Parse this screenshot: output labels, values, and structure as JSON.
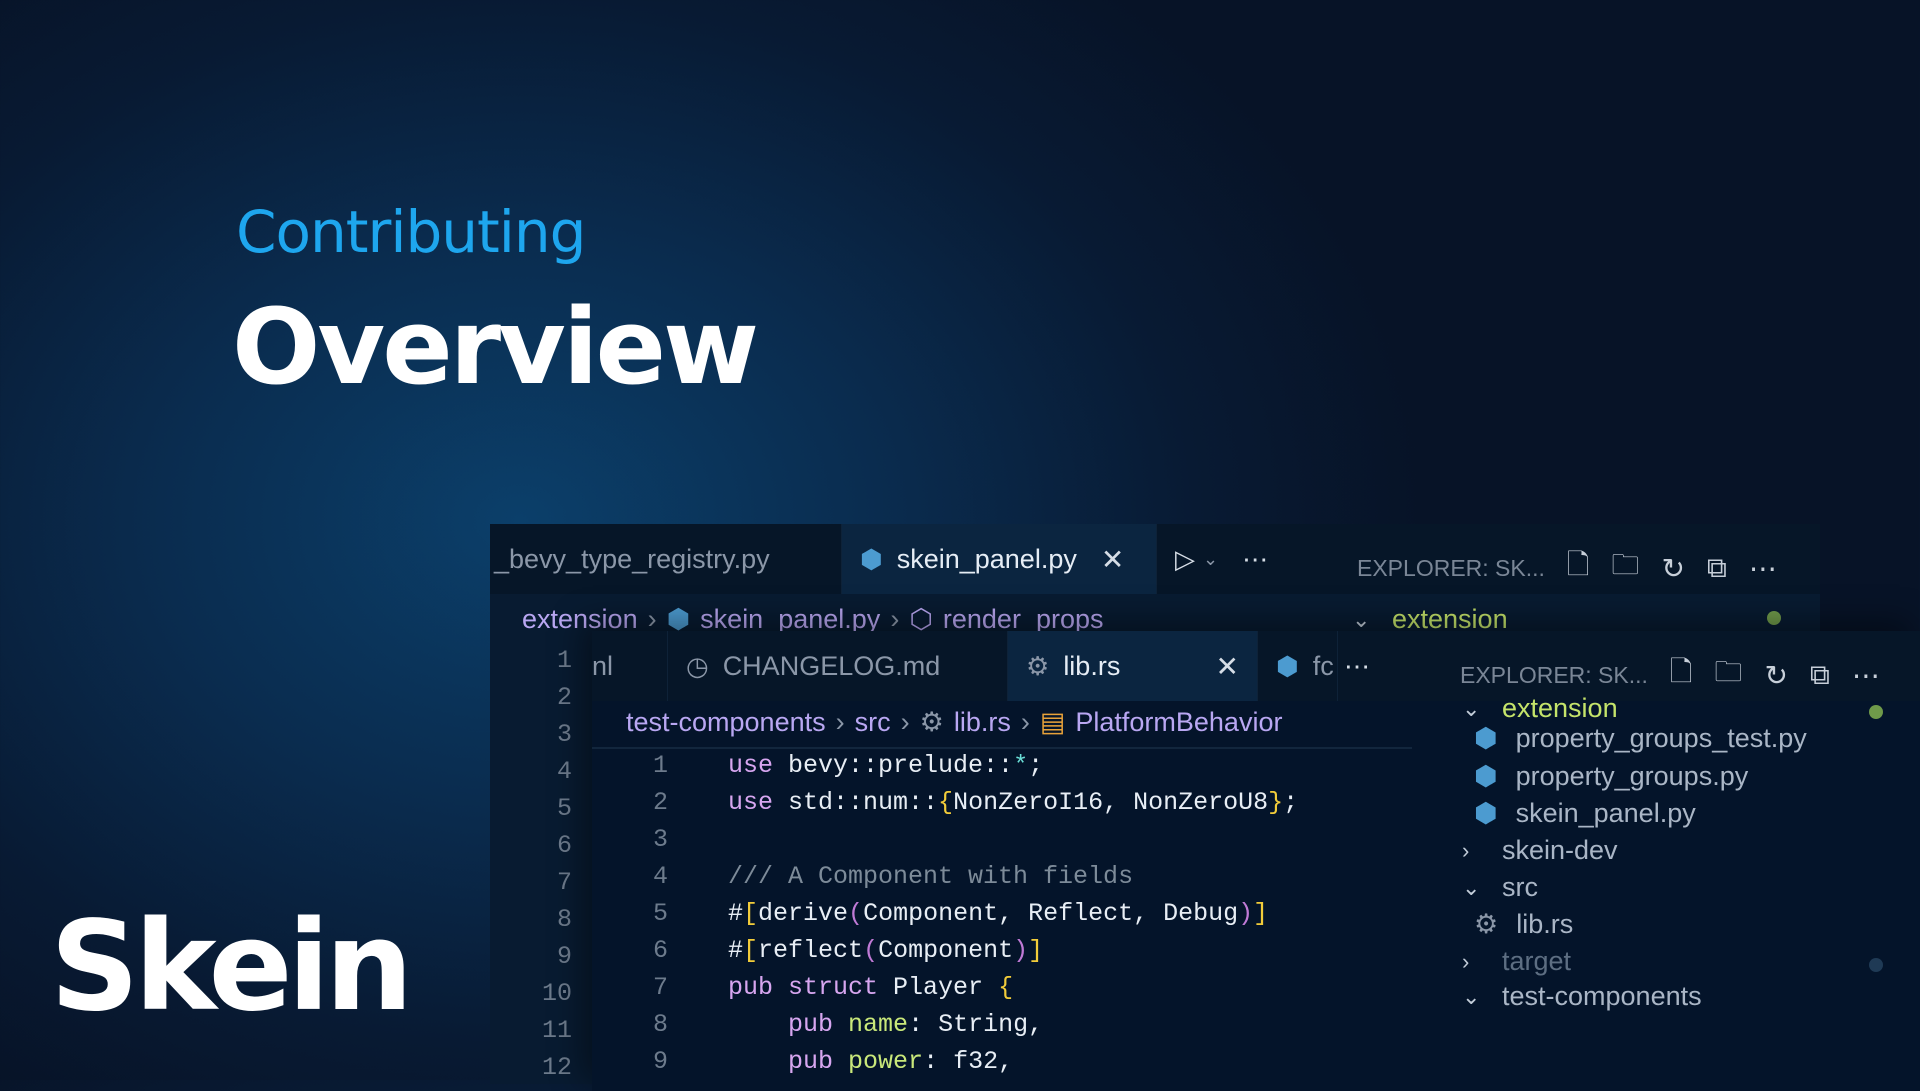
{
  "hero": {
    "subtitle": "Contributing",
    "title": "Overview",
    "logo": "Skein"
  },
  "back_window": {
    "tabs": [
      {
        "label": "_bevy_type_registry.py",
        "icon": "python-icon"
      },
      {
        "label": "skein_panel.py",
        "icon": "python-icon",
        "active": true
      }
    ],
    "breadcrumb": [
      "extension",
      "skein_panel.py",
      "render_props"
    ],
    "line_numbers": [
      "1",
      "2",
      "3",
      "4",
      "5",
      "6",
      "7",
      "8",
      "9",
      "10",
      "11",
      "12"
    ],
    "explorer": {
      "title": "EXPLORER: SK...",
      "folder": "extension"
    }
  },
  "front_window": {
    "tabs": [
      {
        "label": "nl"
      },
      {
        "label": "CHANGELOG.md",
        "icon": "clock-icon"
      },
      {
        "label": "lib.rs",
        "icon": "rust-icon",
        "active": true
      },
      {
        "label": "fc",
        "icon": "python-icon"
      }
    ],
    "breadcrumb": [
      "test-components",
      "src",
      "lib.rs",
      "PlatformBehavior"
    ],
    "line_numbers": [
      "1",
      "2",
      "3",
      "4",
      "5",
      "6",
      "7",
      "8",
      "9"
    ],
    "code": [
      "use bevy::prelude::*;",
      "use std::num::{NonZeroI16, NonZeroU8};",
      "",
      "/// A Component with fields",
      "#[derive(Component, Reflect, Debug)]",
      "#[reflect(Component)]",
      "pub struct Player {",
      "    pub name: String,",
      "    pub power: f32,"
    ],
    "explorer": {
      "title": "EXPLORER: SK...",
      "items": [
        {
          "label": "extension",
          "type": "folder-open",
          "color": "#c5e46a",
          "dot": "#6f9a4a"
        },
        {
          "label": "property_groups_test.py",
          "type": "python"
        },
        {
          "label": "property_groups.py",
          "type": "python"
        },
        {
          "label": "skein_panel.py",
          "type": "python"
        },
        {
          "label": "skein-dev",
          "type": "folder-closed"
        },
        {
          "label": "src",
          "type": "folder-open"
        },
        {
          "label": "lib.rs",
          "type": "rust"
        },
        {
          "label": "target",
          "type": "folder-closed",
          "dim": true,
          "dot": "#1f3a55"
        },
        {
          "label": "test-components",
          "type": "folder-open"
        }
      ]
    }
  },
  "colors": {
    "accent": "#1ea6ee",
    "breadcrumb": "#b9a7f2",
    "folder_highlight": "#c5e46a"
  }
}
